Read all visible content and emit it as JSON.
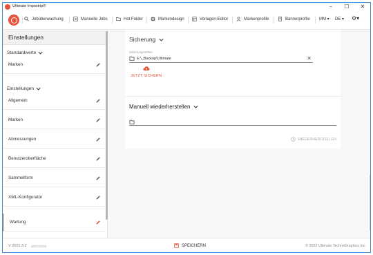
{
  "window": {
    "title": "Ultimate Impostrip®",
    "minimize": "–",
    "maximize": "☐",
    "close": "✕"
  },
  "toolbar": {
    "items": [
      {
        "label": "Jobüberwachung",
        "icon": "search-icon"
      },
      {
        "label": "Manuelle Jobs",
        "icon": "manual-jobs-icon"
      },
      {
        "label": "Hot Folder",
        "icon": "folder-icon"
      },
      {
        "label": "Markendesign",
        "icon": "mark-design-icon"
      },
      {
        "label": "Vorlagen-Editor",
        "icon": "template-icon"
      },
      {
        "label": "Markenprofile",
        "icon": "profile-icon"
      },
      {
        "label": "Bannerprofile",
        "icon": "banner-icon"
      }
    ],
    "user": "MM ▾",
    "language": "DE ▾",
    "settings": "⚙▾"
  },
  "sidebar": {
    "header": "Einstellungen",
    "sections": [
      {
        "title": "Standardwerte",
        "items": [
          "Marken"
        ]
      },
      {
        "title": "Einstellungen",
        "items": [
          "Allgemein",
          "Marken",
          "Abmessungen",
          "Benutzeroberfläche",
          "Sammelform",
          "XML-Konfigurator"
        ]
      }
    ],
    "active_item": "Wartung"
  },
  "main": {
    "sicherung": {
      "title": "Sicherung",
      "field_label": "Sicherungsordner",
      "path": "E:\\_Backup\\Ultimate",
      "backup_button": "JETZT SICHERN"
    },
    "restore": {
      "title": "Manuell wiederherstellen",
      "button": "WIEDERHERSTELLEN"
    }
  },
  "footer": {
    "version": "V 2021.3.2",
    "hash": "ab0d193eb",
    "save": "SPEICHERN",
    "copyright": "© 2022 Ultimate TechnoGraphics Inc."
  },
  "colors": {
    "accent": "#e5533a",
    "border": "#3c8cd6"
  }
}
